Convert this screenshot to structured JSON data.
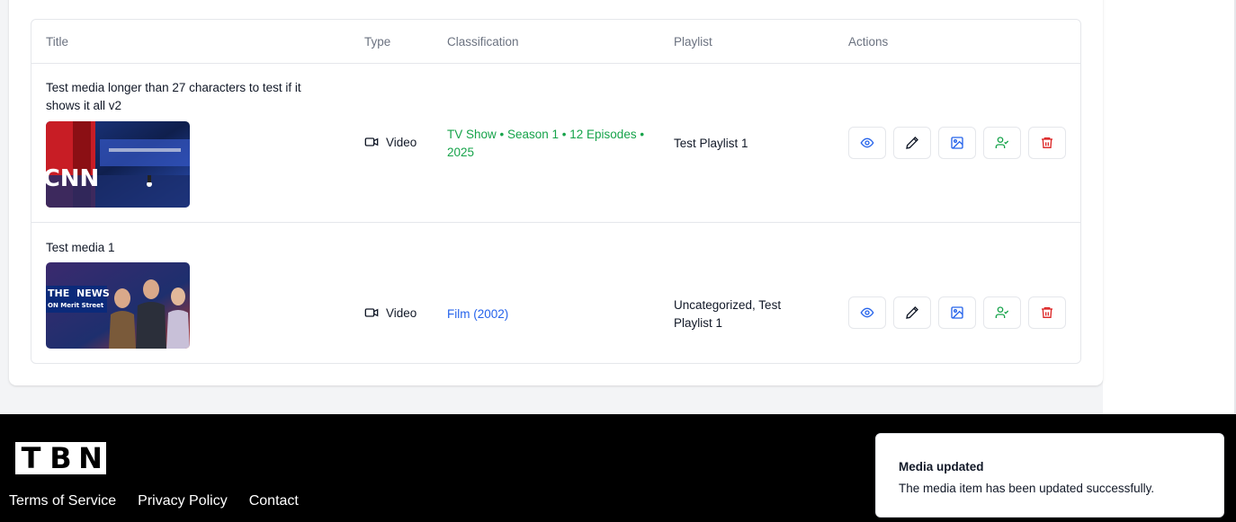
{
  "table": {
    "headers": {
      "title": "Title",
      "type": "Type",
      "classification": "Classification",
      "playlist": "Playlist",
      "actions": "Actions"
    },
    "rows": [
      {
        "title": "Test media longer than 27 characters to test if it shows it all v2",
        "thumbnail_text": "CNN",
        "type": "Video",
        "classification": "TV Show • Season 1 • 12 Episodes • 2025",
        "playlist": "Test Playlist 1"
      },
      {
        "title": "Test media 1",
        "thumbnail_text_1": "THE",
        "thumbnail_text_2": "NEWS",
        "thumbnail_text_3": "ON Merit Street",
        "type": "Video",
        "classification": "Film (2002)",
        "playlist": "Uncategorized, Test Playlist 1"
      }
    ],
    "action_icons": [
      "eye-icon",
      "pencil-icon",
      "image-icon",
      "user-check-icon",
      "trash-icon"
    ]
  },
  "footer": {
    "logo_letters": [
      "T",
      "B",
      "N"
    ],
    "links": [
      "Terms of Service",
      "Privacy Policy",
      "Contact"
    ]
  },
  "toast": {
    "title": "Media updated",
    "description": "The media item has been updated successfully."
  },
  "colors": {
    "green": "#16a34a",
    "blue": "#2563eb",
    "red": "#dc2626",
    "border": "#e5e7eb"
  }
}
